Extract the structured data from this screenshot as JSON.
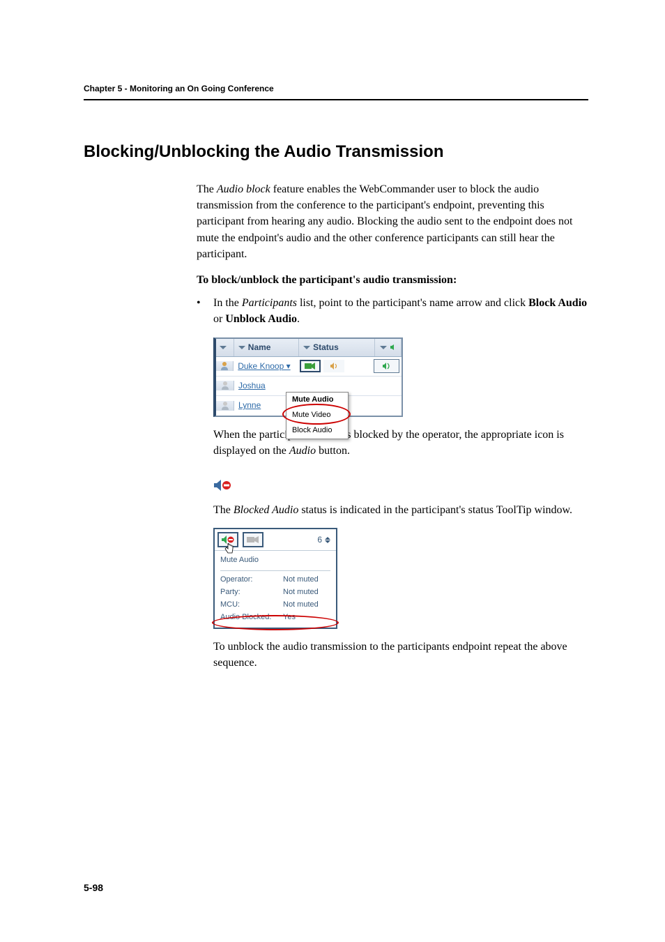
{
  "chapter_header": "Chapter 5 - Monitoring an On Going Conference",
  "section_title": "Blocking/Unblocking the Audio Transmission",
  "intro": {
    "prefix": "The ",
    "feature_name": "Audio block",
    "rest": " feature enables the WebCommander user to block the audio transmission from the conference to the participant's endpoint, preventing this participant from hearing any audio. Blocking the audio sent to the endpoint does not mute the endpoint's audio and the other conference participants can still hear the participant."
  },
  "subheading": "To block/unblock the participant's audio transmission:",
  "bullet": {
    "marker": "•",
    "prefix": "In the ",
    "list_name": "Participants",
    "mid": " list, point to the participant's name arrow and click ",
    "opt1": "Block Audio",
    "or": " or ",
    "opt2": "Unblock Audio",
    "end": "."
  },
  "participants_table": {
    "headers": {
      "name": "Name",
      "status": "Status"
    },
    "rows": [
      {
        "name": "Duke Knoop ▾"
      },
      {
        "name": "Joshua"
      },
      {
        "name": "Lynne"
      }
    ],
    "context_menu": {
      "items": [
        "Mute Audio",
        "Mute Video",
        "Block Audio"
      ]
    }
  },
  "after_table": {
    "prefix": "When the participant's audio is blocked by the operator, the appropriate icon is displayed on the ",
    "btn": "Audio",
    "suffix": " button."
  },
  "blocked_status_para": {
    "prefix": "The ",
    "term": "Blocked Audio",
    "suffix": " status is indicated in the participant's status ToolTip window."
  },
  "tooltip": {
    "number": "6",
    "section": "Mute Audio",
    "rows": [
      {
        "label": "Operator:",
        "value": "Not muted"
      },
      {
        "label": "Party:",
        "value": "Not muted"
      },
      {
        "label": "MCU:",
        "value": "Not muted"
      }
    ],
    "blocked_row": {
      "label": "Audio Blocked:",
      "value": "Yes"
    }
  },
  "unblock_para": "To unblock the audio transmission to the participants endpoint repeat the above sequence.",
  "page_number": "5-98"
}
